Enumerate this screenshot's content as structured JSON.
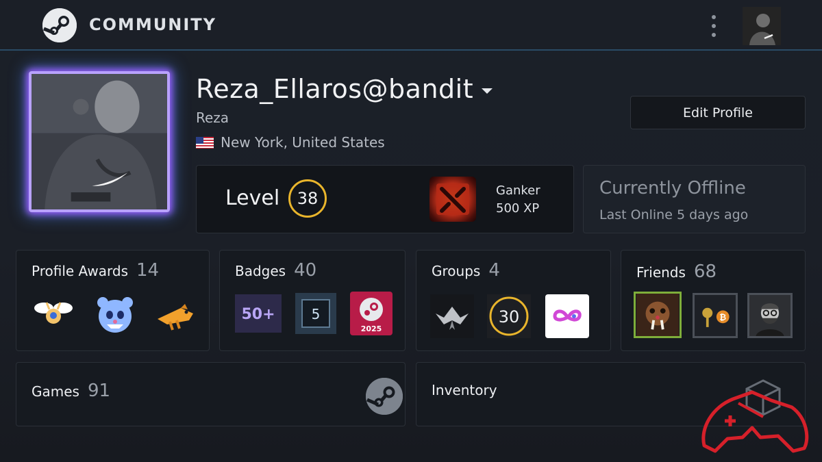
{
  "header": {
    "brand": "COMMUNITY",
    "logo_icon": "steam-logo-icon",
    "menu_icon": "kebab-menu-icon"
  },
  "profile": {
    "username": "Reza_Ellaros@bandit",
    "real_name": "Reza",
    "location": "New York, United States",
    "flag_icon": "us-flag-icon",
    "edit_label": "Edit Profile"
  },
  "level": {
    "label": "Level",
    "value": "38",
    "badge_name": "Ganker",
    "badge_xp": "500 XP"
  },
  "status": {
    "title": "Currently Offline",
    "subtitle": "Last Online 5 days ago"
  },
  "cards": {
    "awards": {
      "label": "Profile Awards",
      "count": "14"
    },
    "badges": {
      "label": "Badges",
      "count": "40",
      "items": [
        "50+",
        "5",
        "2025"
      ]
    },
    "groups": {
      "label": "Groups",
      "count": "4",
      "items": [
        "30"
      ]
    },
    "friends": {
      "label": "Friends",
      "count": "68"
    },
    "games": {
      "label": "Games",
      "count": "91"
    },
    "inventory": {
      "label": "Inventory"
    }
  },
  "colors": {
    "accent_gold": "#e9b52c",
    "background": "#1b1f27",
    "panel": "#161a20"
  }
}
